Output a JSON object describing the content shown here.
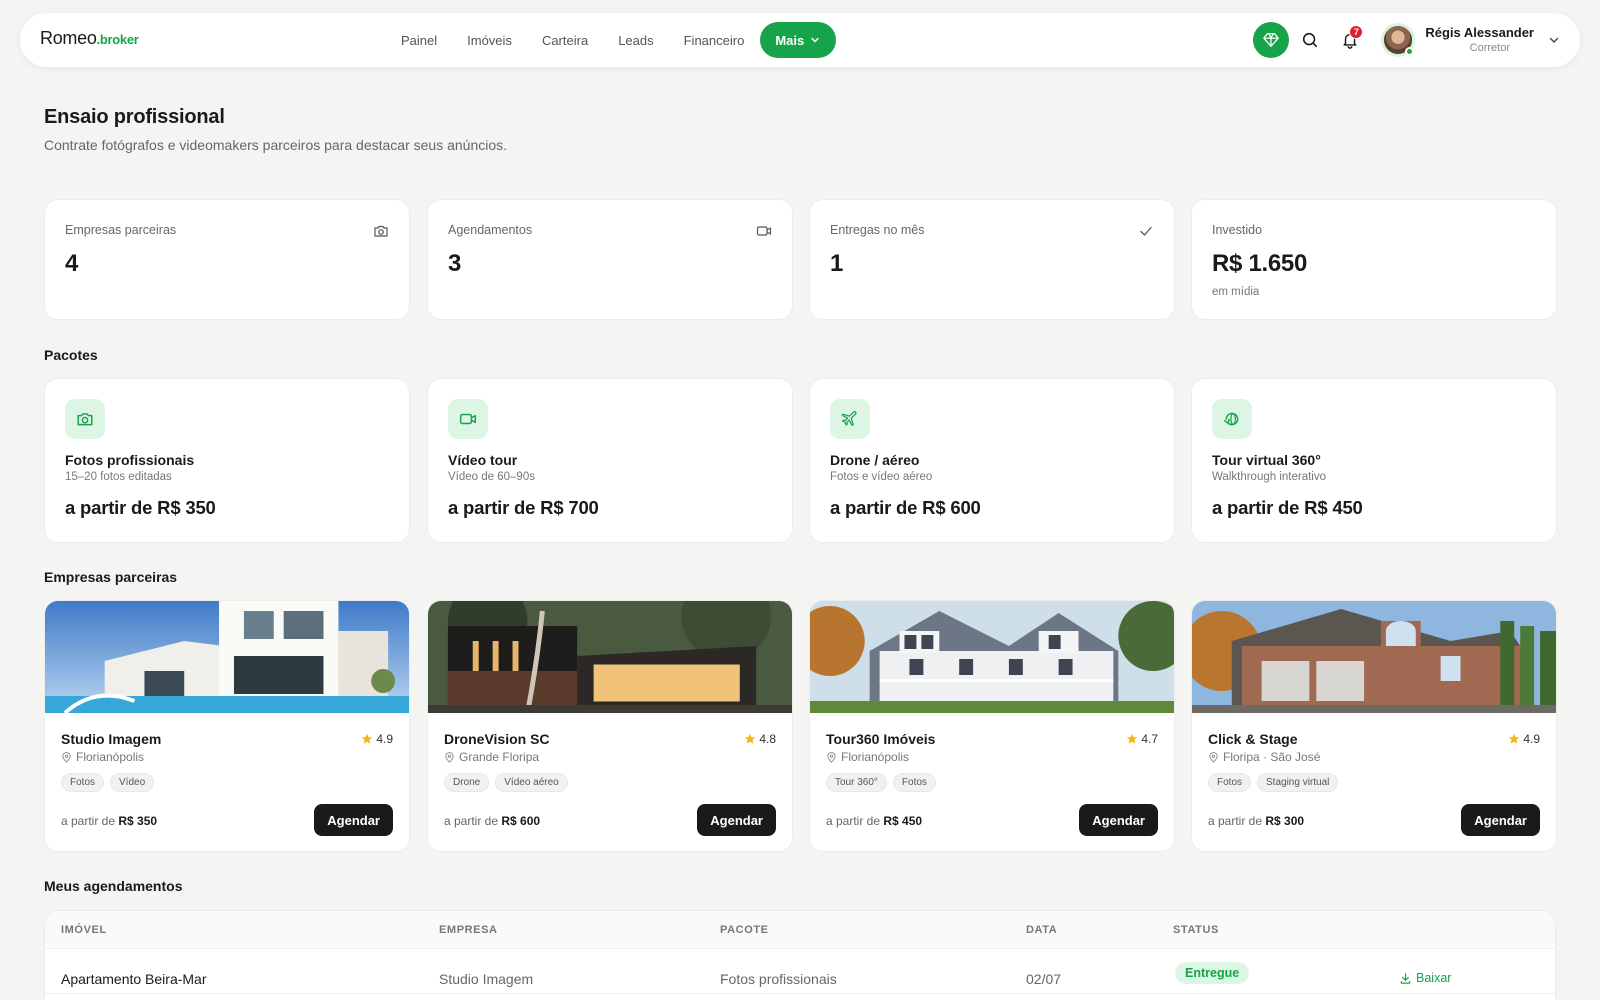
{
  "header": {
    "logo_main": "Romeo",
    "logo_sub": ".broker",
    "nav": [
      "Painel",
      "Imóveis",
      "Carteira",
      "Leads",
      "Financeiro"
    ],
    "more_label": "Mais",
    "notifications_count": "7",
    "user_name": "Régis Alessander",
    "user_role": "Corretor"
  },
  "page": {
    "title": "Ensaio profissional",
    "subtitle": "Contrate fotógrafos e videomakers parceiros para destacar seus anúncios."
  },
  "stats": [
    {
      "label": "Empresas parceiras",
      "value": "4",
      "icon": "camera-icon"
    },
    {
      "label": "Agendamentos",
      "value": "3",
      "icon": "video-icon"
    },
    {
      "label": "Entregas no mês",
      "value": "1",
      "icon": "check-icon"
    },
    {
      "label": "Investido",
      "value": "R$ 1.650",
      "note": "em mídia"
    }
  ],
  "packages_title": "Pacotes",
  "packages": [
    {
      "name": "Fotos profissionais",
      "desc": "15–20 fotos editadas",
      "price": "a partir de R$ 350",
      "icon": "camera-icon"
    },
    {
      "name": "Vídeo tour",
      "desc": "Vídeo de 60–90s",
      "price": "a partir de R$ 700",
      "icon": "video-icon"
    },
    {
      "name": "Drone / aéreo",
      "desc": "Fotos e vídeo aéreo",
      "price": "a partir de R$ 600",
      "icon": "plane-icon"
    },
    {
      "name": "Tour virtual 360°",
      "desc": "Walkthrough interativo",
      "price": "a partir de R$ 450",
      "icon": "rotate-360-icon"
    }
  ],
  "partners_title": "Empresas parceiras",
  "partners": [
    {
      "name": "Studio Imagem",
      "rating": "4.9",
      "location": "Florianópolis",
      "tags": [
        "Fotos",
        "Vídeo"
      ],
      "price_prefix": "a partir de",
      "price": "R$ 350",
      "button": "Agendar"
    },
    {
      "name": "DroneVision SC",
      "rating": "4.8",
      "location": "Grande Floripa",
      "tags": [
        "Drone",
        "Vídeo aéreo"
      ],
      "price_prefix": "a partir de",
      "price": "R$ 600",
      "button": "Agendar"
    },
    {
      "name": "Tour360 Imóveis",
      "rating": "4.7",
      "location": "Florianópolis",
      "tags": [
        "Tour 360°",
        "Fotos"
      ],
      "price_prefix": "a partir de",
      "price": "R$ 450",
      "button": "Agendar"
    },
    {
      "name": "Click & Stage",
      "rating": "4.9",
      "location": "Floripa · São José",
      "tags": [
        "Fotos",
        "Staging virtual"
      ],
      "price_prefix": "a partir de",
      "price": "R$ 300",
      "button": "Agendar"
    }
  ],
  "bookings_title": "Meus agendamentos",
  "bookings": {
    "columns": [
      "IMÓVEL",
      "EMPRESA",
      "PACOTE",
      "DATA",
      "STATUS"
    ],
    "rows": [
      {
        "imovel": "Apartamento Beira-Mar",
        "empresa": "Studio Imagem",
        "pacote": "Fotos profissionais",
        "data": "02/07",
        "status": "Entregue",
        "action": "Baixar"
      }
    ]
  },
  "colors": {
    "accent": "#17a34a",
    "accent_soft": "#dcf5e4",
    "dark": "#1a1a1a",
    "star": "#f5b50a",
    "badge": "#e11d2a"
  }
}
